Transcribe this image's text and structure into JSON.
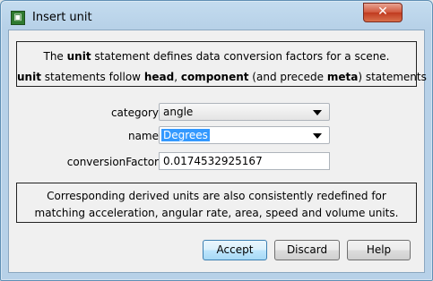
{
  "window": {
    "title": "Insert unit",
    "close_label": "✕"
  },
  "info_top": {
    "line1_prefix": "The ",
    "line1_bold": "unit",
    "line1_suffix": " statement defines data conversion factors for a scene.",
    "line2_bold1": "unit",
    "line2_text1": " statements follow ",
    "line2_bold2": "head",
    "line2_text2": ", ",
    "line2_bold3": "component",
    "line2_text3": " (and precede ",
    "line2_bold4": "meta",
    "line2_text4": ") statements"
  },
  "form": {
    "category_label": "category",
    "category_value": "angle",
    "name_label": "name",
    "name_value": "Degrees",
    "factor_label": "conversionFactor",
    "factor_value": "0.0174532925167"
  },
  "info_bottom": {
    "line1": "Corresponding derived units are also consistently redefined for",
    "line2": "matching acceleration, angular rate, area, speed and volume units."
  },
  "buttons": {
    "accept": "Accept",
    "discard": "Discard",
    "help": "Help"
  },
  "icons": {
    "app": "x3d-app-icon",
    "close": "close-icon",
    "dropdown": "chevron-down-icon"
  }
}
